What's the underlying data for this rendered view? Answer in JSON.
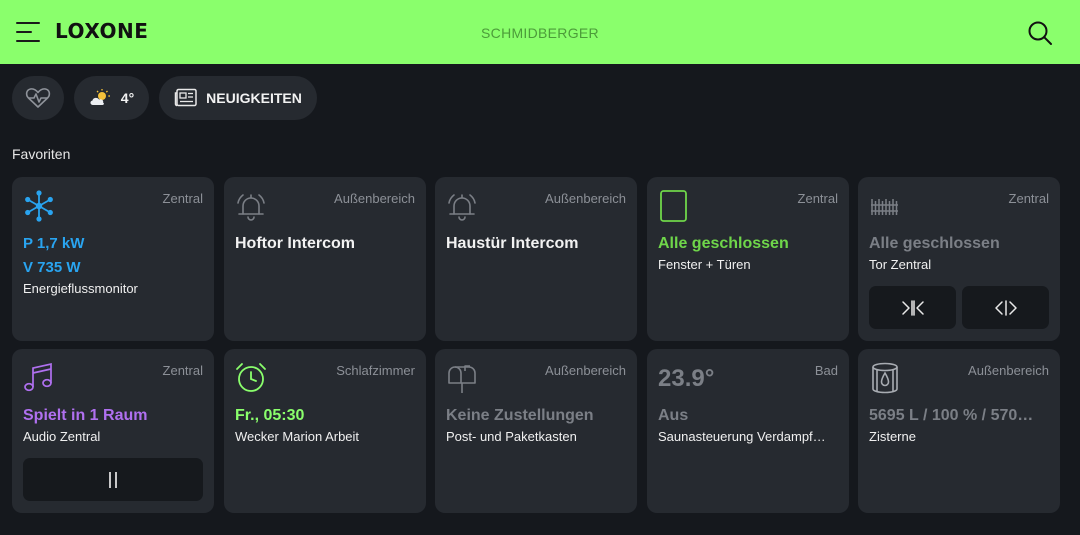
{
  "header": {
    "logo": "LOXONE",
    "title": "SCHMIDBERGER"
  },
  "quickbar": {
    "weather_temp": "4°",
    "news_label": "NEUIGKEITEN"
  },
  "section_title": "Favoriten",
  "colors": {
    "header_bg": "#8aff6c",
    "blue": "#29a4f0",
    "green": "#6fd64a",
    "purple": "#b070f0",
    "lime": "#8aff6c",
    "gray": "#7b7f86"
  },
  "cards": [
    {
      "room": "Zentral",
      "line1": "P 1,7 kW",
      "line2": "V 735 W",
      "name": "Energieflussmonitor",
      "icon": "energy-flow-icon"
    },
    {
      "room": "Außenbereich",
      "state": "Hoftor Intercom",
      "icon": "bell-icon"
    },
    {
      "room": "Außenbereich",
      "state": "Haustür Intercom",
      "icon": "bell-icon"
    },
    {
      "room": "Zentral",
      "state": "Alle geschlossen",
      "name": "Fenster + Türen",
      "icon": "window-icon"
    },
    {
      "room": "Zentral",
      "state": "Alle geschlossen",
      "name": "Tor Zentral",
      "icon": "gate-icon"
    },
    {
      "room": "Zentral",
      "state": "Spielt in 1 Raum",
      "name": "Audio Zentral",
      "icon": "music-note-icon"
    },
    {
      "room": "Schlafzimmer",
      "state": "Fr., 05:30",
      "name": "Wecker Marion Arbeit",
      "icon": "alarm-clock-icon"
    },
    {
      "room": "Außenbereich",
      "state": "Keine Zustellungen",
      "name": "Post- und Paketkasten",
      "icon": "mailbox-icon"
    },
    {
      "room": "Bad",
      "value": "23.9°",
      "state": "Aus",
      "name": "Saunasteuerung Verdampf…",
      "icon": "sauna-icon"
    },
    {
      "room": "Außenbereich",
      "state": "5695 L / 100 % / 570…",
      "name": "Zisterne",
      "icon": "tank-icon"
    }
  ]
}
